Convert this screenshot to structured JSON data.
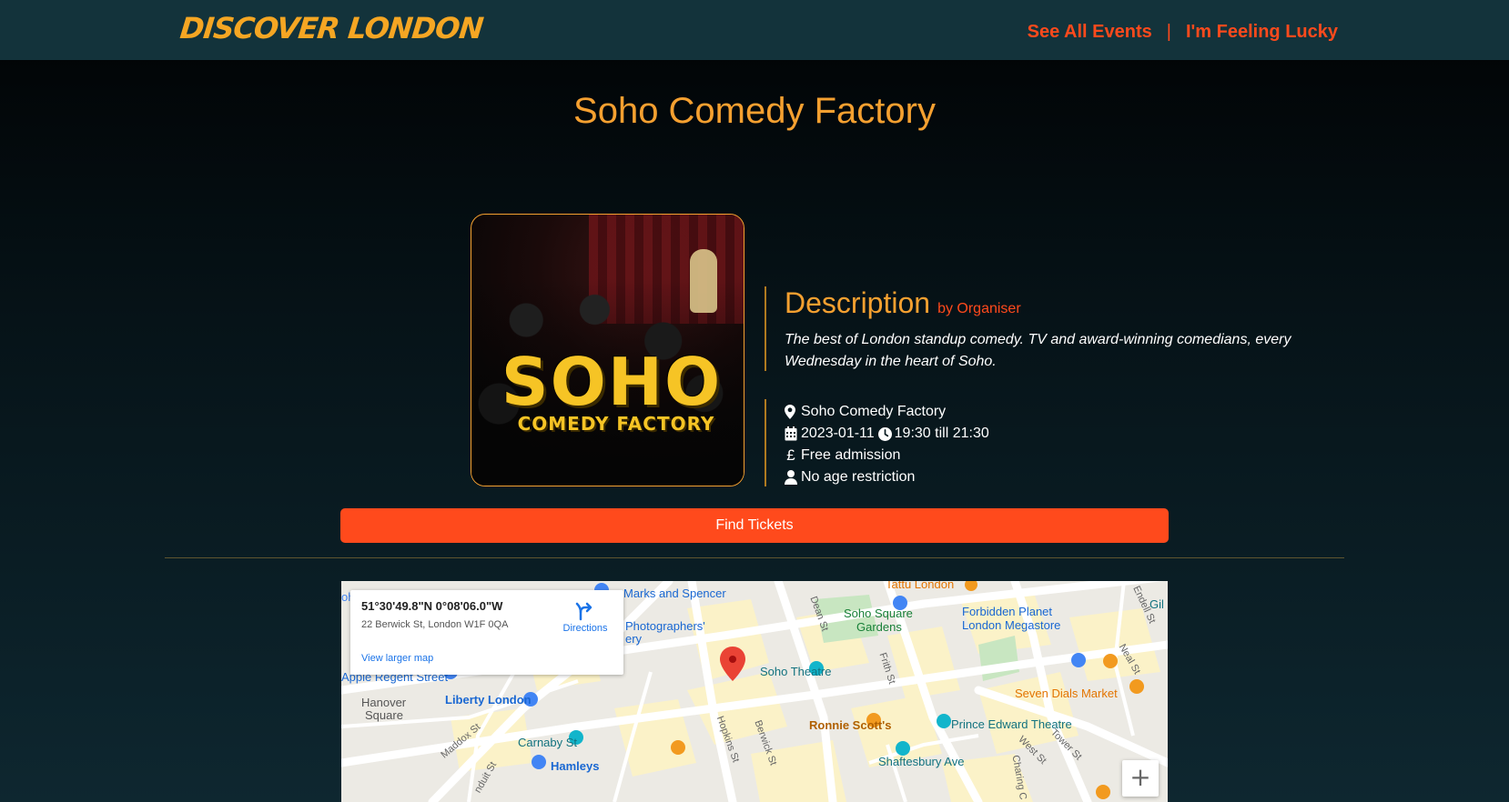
{
  "header": {
    "brand": "Discover London",
    "nav": [
      {
        "label": "See All Events"
      },
      {
        "label": "I'm Feeling Lucky"
      }
    ],
    "separator": "|"
  },
  "event": {
    "title": "Soho Comedy Factory",
    "image_logo_main": "SOHO",
    "image_logo_sub": "Comedy Factory",
    "description_heading": "Description",
    "description_by": "by Organiser",
    "description_text": "The best of London standup comedy. TV and award-winning comedians, every Wednesday in the heart of Soho.",
    "venue": "Soho Comedy Factory",
    "date": "2023-01-11",
    "time": "19:30 till 21:30",
    "price": "Free admission",
    "age": "No age restriction",
    "tickets_label": "Find Tickets"
  },
  "icons": {
    "venue": "map-marker-icon",
    "date": "calendar-icon",
    "time": "clock-icon",
    "price": "pound-icon",
    "age": "user-icon"
  },
  "map": {
    "coords": "51°30'49.8\"N 0°08'06.0\"W",
    "address": "22 Berwick St, London W1F 0QA",
    "directions_label": "Directions",
    "larger_map_label": "View larger map",
    "zoom_in_label": "+",
    "places": {
      "tattu": "Tattu London",
      "marks": "Marks and Spencer",
      "soho_square": "Soho Square",
      "soho_square_2": "Gardens",
      "forbidden_1": "Forbidden Planet",
      "forbidden_2": "London Megastore",
      "photographers": "Photographers'",
      "photographers_2": "ery",
      "apple": "Apple Regent Street",
      "soho_theatre": "Soho Theatre",
      "seven_dials": "Seven Dials Market",
      "hanover_1": "Hanover",
      "hanover_2": "Square",
      "liberty": "Liberty London",
      "ronnie": "Ronnie Scott's",
      "prince_edward": "Prince Edward Theatre",
      "carnaby": "Carnaby St",
      "hamleys": "Hamleys",
      "shaftesbury": "Shaftesbury Ave",
      "dean_st": "Dean St",
      "frith_st": "Frith St",
      "berwick_st": "Berwick St",
      "hopkins_st": "Hopkins St",
      "maddox_st": "Maddox St",
      "conduit_st": "nduit St",
      "neal_st": "Neal St",
      "endell_st": "Endell St",
      "west_st": "West St",
      "tower_st": "Tower St",
      "charing": "Charing C",
      "gil": "Gil",
      "oh": "oh"
    },
    "colors": {
      "land": "#eceae4",
      "road": "#ffffff",
      "block": "#fbf2c8",
      "park": "#c8e6c1",
      "pin": "#ea4335",
      "shop": "#4285f4",
      "food": "#f29a1f",
      "theatre": "#12b5cb"
    }
  },
  "colors": {
    "accent_orange": "#f5a030",
    "accent_red": "#ff4a1c",
    "header_bg": "#13333b"
  }
}
